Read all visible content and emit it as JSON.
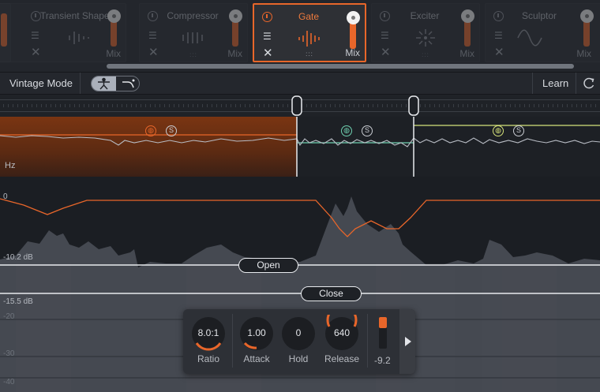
{
  "modules": [
    {
      "title": "Transient Shaper",
      "mix": "Mix"
    },
    {
      "title": "Compressor",
      "mix": "Mix"
    },
    {
      "title": "Gate",
      "mix": "Mix",
      "x_label": "✕",
      "menu_label": "☰",
      "dots": ":::"
    },
    {
      "title": "Exciter",
      "mix": "Mix"
    },
    {
      "title": "Sculptor",
      "mix": "Mix"
    }
  ],
  "active_module": "Gate",
  "toolbar": {
    "vintage_mode": "Vintage Mode",
    "learn": "Learn"
  },
  "spectrum": {
    "hz_label": "Hz",
    "solo_label": "S"
  },
  "waveform": {
    "db_labels": [
      "0",
      "-10.2 dB",
      "-15.5 dB",
      "-20",
      "-30",
      "-40"
    ],
    "open_label": "Open",
    "close_label": "Close"
  },
  "controls": {
    "ratio": {
      "value": "8.0:1",
      "label": "Ratio"
    },
    "attack": {
      "value": "1.00",
      "label": "Attack"
    },
    "hold": {
      "value": "0",
      "label": "Hold"
    },
    "release": {
      "value": "640",
      "label": "Release"
    },
    "meter_value": "-9.2"
  },
  "colors": {
    "accent": "#e8662a",
    "band2": "#6fd0b0",
    "band3": "#d6e27a"
  }
}
